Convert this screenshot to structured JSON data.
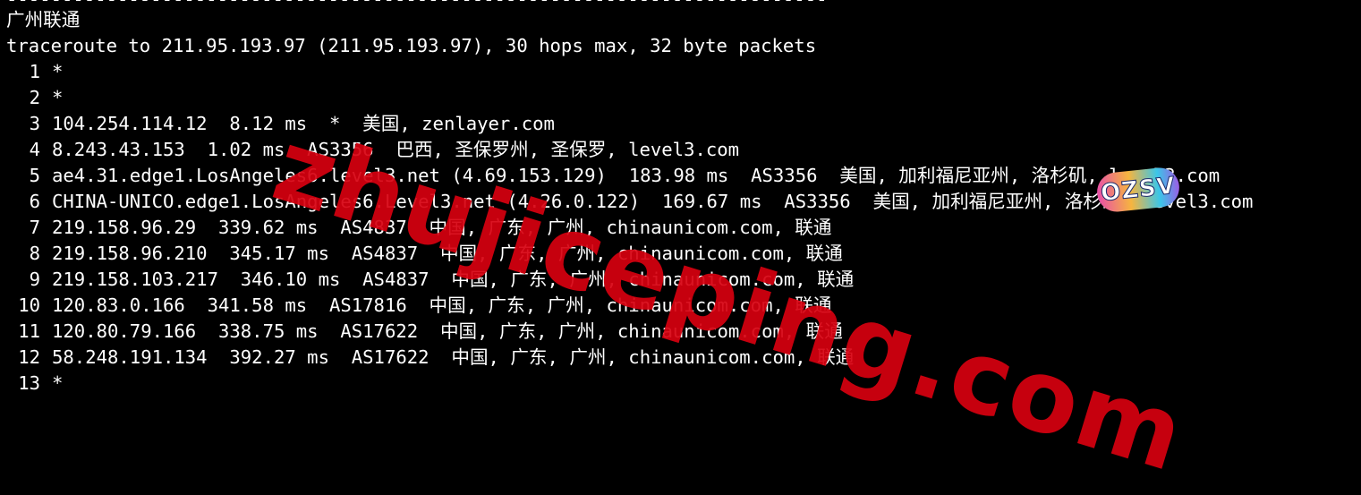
{
  "terminal": {
    "separator": "--------------------------------------------------------------------------",
    "region_title": "广州联通",
    "command_line": "traceroute to 211.95.193.97 (211.95.193.97), 30 hops max, 32 byte packets",
    "hops": [
      {
        "num": "1",
        "body": "*"
      },
      {
        "num": "2",
        "body": "*"
      },
      {
        "num": "3",
        "body": "104.254.114.12  8.12 ms  *  美国, zenlayer.com"
      },
      {
        "num": "4",
        "body": "8.243.43.153  1.02 ms  AS3356  巴西, 圣保罗州, 圣保罗, level3.com"
      },
      {
        "num": "5",
        "body": "ae4.31.edge1.LosAngeles6.level3.net (4.69.153.129)  183.98 ms  AS3356  美国, 加利福尼亚州, 洛杉矶, level3.com"
      },
      {
        "num": "6",
        "body": "CHINA-UNICO.edge1.LosAngeles6.Level3.net (4.26.0.122)  169.67 ms  AS3356  美国, 加利福尼亚州, 洛杉矶, level3.com"
      },
      {
        "num": "7",
        "body": "219.158.96.29  339.62 ms  AS4837  中国, 广东, 广州, chinaunicom.com, 联通"
      },
      {
        "num": "8",
        "body": "219.158.96.210  345.17 ms  AS4837  中国, 广东, 广州, chinaunicom.com, 联通"
      },
      {
        "num": "9",
        "body": "219.158.103.217  346.10 ms  AS4837  中国, 广东, 广州, chinaunicom.com, 联通"
      },
      {
        "num": "10",
        "body": "120.83.0.166  341.58 ms  AS17816  中国, 广东, 广州, chinaunicom.com, 联通"
      },
      {
        "num": "11",
        "body": "120.80.79.166  338.75 ms  AS17622  中国, 广东, 广州, chinaunicom.com, 联通"
      },
      {
        "num": "12",
        "body": "58.248.191.134  392.27 ms  AS17622  中国, 广东, 广州, chinaunicom.com, 联通"
      },
      {
        "num": "13",
        "body": "*"
      }
    ]
  },
  "watermark": {
    "text": "zhujiceping.com",
    "color": "#d7000f",
    "logo_text": "OZSV"
  },
  "colors": {
    "background": "#000000",
    "foreground": "#ffffff"
  }
}
